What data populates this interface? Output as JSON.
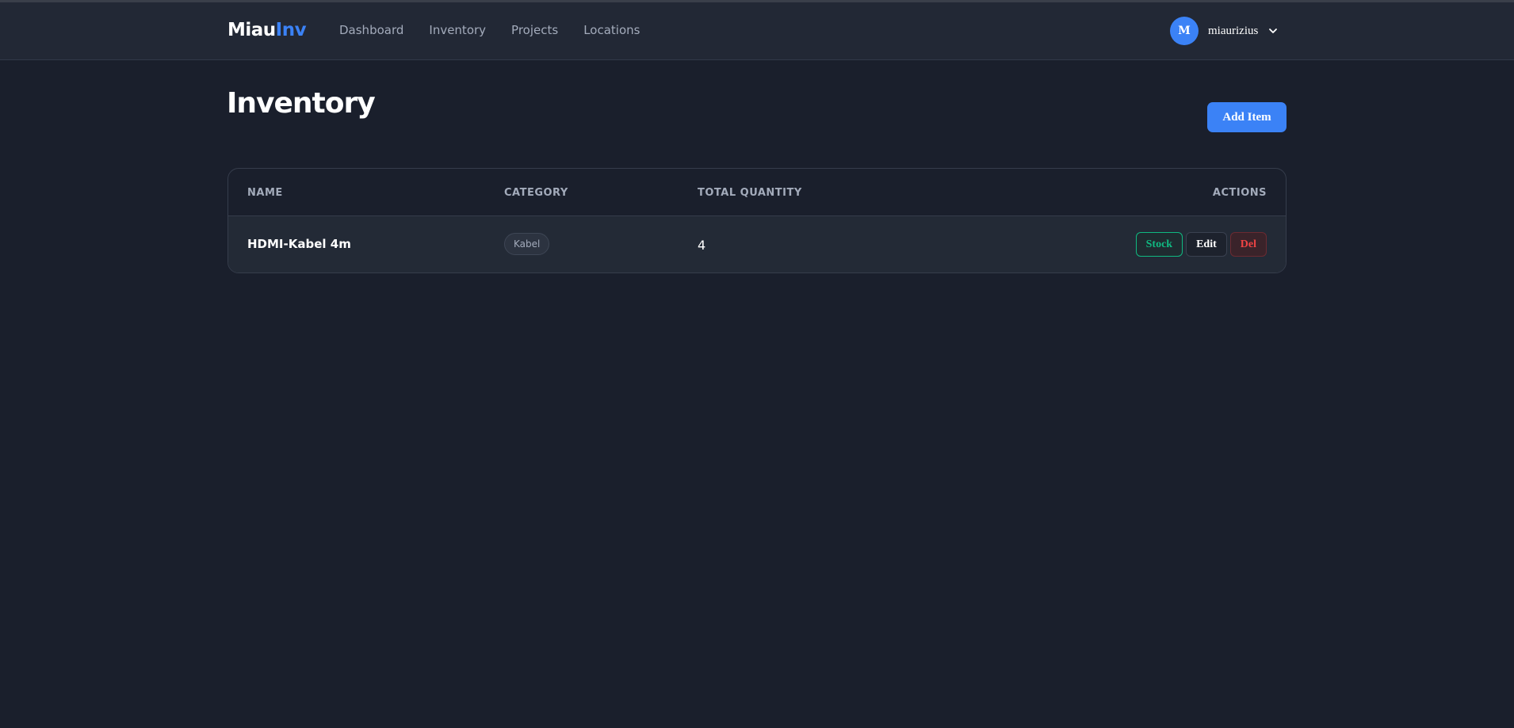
{
  "brand": {
    "part1": "Miau",
    "part2": "Inv"
  },
  "nav": {
    "items": [
      {
        "label": "Dashboard"
      },
      {
        "label": "Inventory"
      },
      {
        "label": "Projects"
      },
      {
        "label": "Locations"
      }
    ]
  },
  "user": {
    "initial": "M",
    "name": "miaurizius"
  },
  "page": {
    "title": "Inventory",
    "add_button": "Add Item"
  },
  "table": {
    "headers": {
      "name": "NAME",
      "category": "CATEGORY",
      "quantity": "TOTAL QUANTITY",
      "actions": "ACTIONS"
    },
    "rows": [
      {
        "name": "HDMI-Kabel 4m",
        "category": "Kabel",
        "quantity": "4",
        "actions": {
          "stock": "Stock",
          "edit": "Edit",
          "delete": "Del"
        }
      }
    ]
  },
  "colors": {
    "background": "#1a1f2c",
    "accent": "#3b82f6",
    "stock": "#10b981",
    "danger": "#ef4444"
  }
}
